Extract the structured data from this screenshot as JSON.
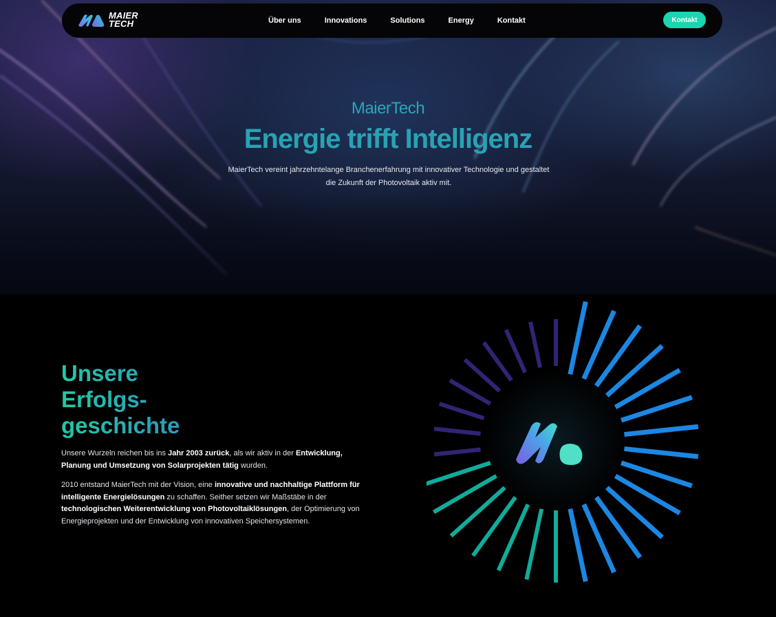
{
  "nav": {
    "logo_line1": "MAIER",
    "logo_line2": "TECH",
    "links": [
      {
        "label": "Über uns"
      },
      {
        "label": "Innovations"
      },
      {
        "label": "Solutions"
      },
      {
        "label": "Energy"
      },
      {
        "label": "Kontakt"
      }
    ],
    "cta_label": "Kontakt",
    "cta_color": "#19d7b1"
  },
  "hero": {
    "brand": "MaierTech",
    "headline": "Energie trifft Intelligenz",
    "subline": "MaierTech vereint jahrzehntelange Branchenerfahrung mit innovativer Technologie und gestaltet die Zukunft der Photovoltaik aktiv mit."
  },
  "story": {
    "title_line1": "Unsere",
    "title_line2": "Erfolgs-",
    "title_line3": "geschichte",
    "p1": {
      "t1": "Unsere Wurzeln reichen bis ins ",
      "b1": "Jahr 2003 zurück",
      "t2": ", als wir aktiv in der ",
      "b2": "Entwicklung, Planung und Umsetzung von Solarprojekten tätig",
      "t3": " wurden."
    },
    "p2": {
      "t1": "2010 entstand MaierTech mit der Vision, eine ",
      "b1": "innovative und nachhaltige Plattform für intelligente Energielösungen",
      "t2": " zu schaffen. Seither setzen wir Maßstäbe in der ",
      "b2": "technologischen Weiterentwicklung von Photovoltaiklösungen",
      "t3": ", der Optimierung von Energieprojekten und der Entwicklung von innovativen Speichersystemen."
    }
  },
  "colors": {
    "accent_teal": "#19d7b1",
    "title_teal": "#27a3b3",
    "ray_blue": "#1e8ff0",
    "ray_purple": "#3d2a8a"
  },
  "icons": [
    "logo-mark-icon",
    "ray-burst-graphic"
  ]
}
